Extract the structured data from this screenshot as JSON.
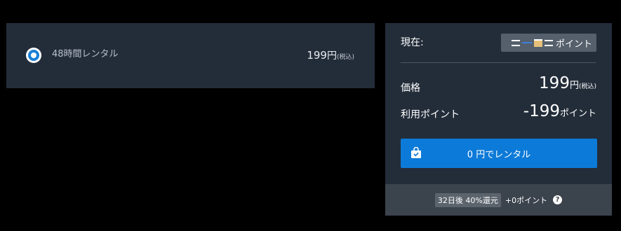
{
  "rental_option": {
    "label": "48時間レンタル",
    "price": "199",
    "currency": "円",
    "tax_note": "(税込)",
    "selected": true
  },
  "summary": {
    "current_label": "現在:",
    "current_points_unit": "ポイント",
    "price_label": "価格",
    "price_value": "199",
    "price_currency": "円",
    "price_tax_note": "(税込)",
    "points_label": "利用ポイント",
    "points_value": "-199",
    "points_unit": "ポイント",
    "rent_button_label": "0 円でレンタル",
    "cashback_badge": "32日後 40%還元",
    "bonus_points": "+0ポイント",
    "help_glyph": "?"
  },
  "colors": {
    "panel_bg": "#232d3a",
    "accent_blue": "#0c7ad8",
    "footer_bg": "#3b434d"
  },
  "icons": [
    "radio-selected-icon",
    "shopping-bag-icon",
    "help-icon"
  ]
}
